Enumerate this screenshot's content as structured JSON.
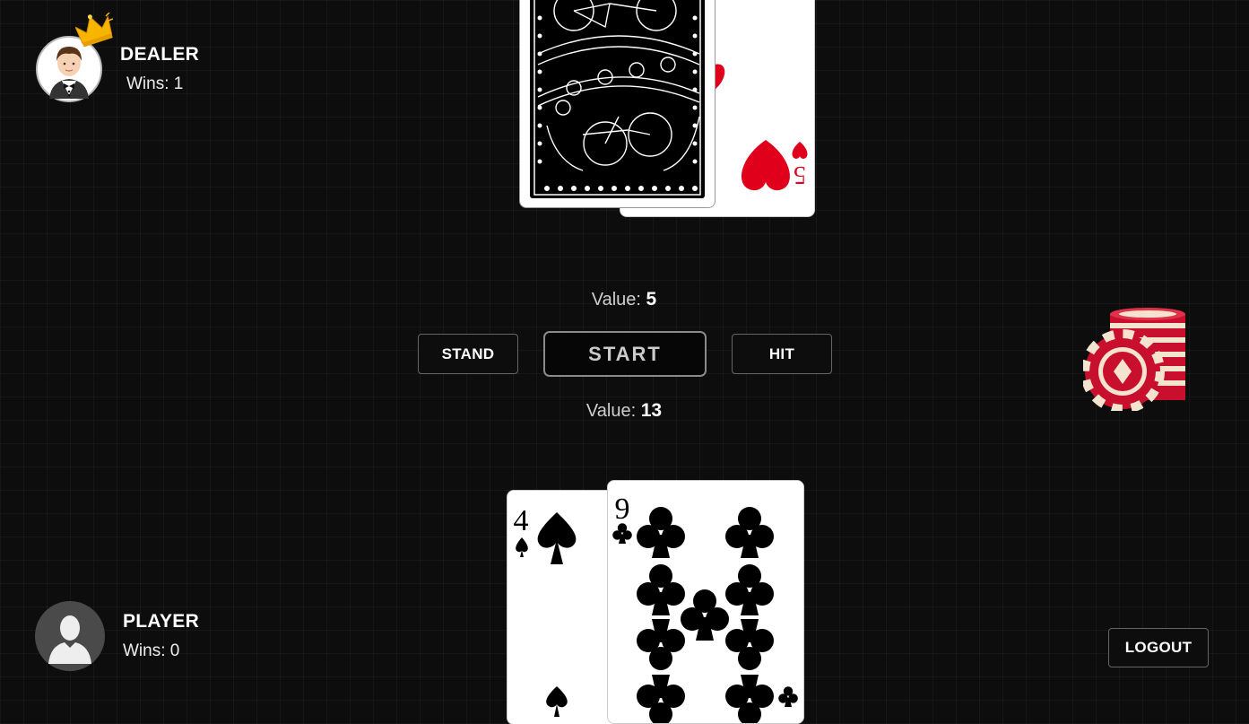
{
  "dealer": {
    "name": "DEALER",
    "wins_label": "Wins: 1"
  },
  "player": {
    "name": "PLAYER",
    "wins_label": "Wins: 0"
  },
  "dealer_hand": {
    "value_label": "Value:",
    "value": "5",
    "cards": [
      {
        "face": "down"
      },
      {
        "rank": "5",
        "suit": "hearts"
      }
    ]
  },
  "player_hand": {
    "value_label": "Value:",
    "value": "13",
    "cards": [
      {
        "rank": "4",
        "suit": "spades"
      },
      {
        "rank": "9",
        "suit": "clubs"
      }
    ]
  },
  "controls": {
    "stand": "STAND",
    "start": "START",
    "hit": "HIT",
    "logout": "LOGOUT"
  },
  "icons": {
    "dealer_avatar": "dealer-avatar-icon",
    "crown": "crown-icon",
    "player_avatar": "user-silhouette-icon",
    "chips": "poker-chips-icon"
  },
  "colors": {
    "background": "#0d0d0d",
    "hearts": "#e0001b",
    "chips": "#c8102e"
  }
}
